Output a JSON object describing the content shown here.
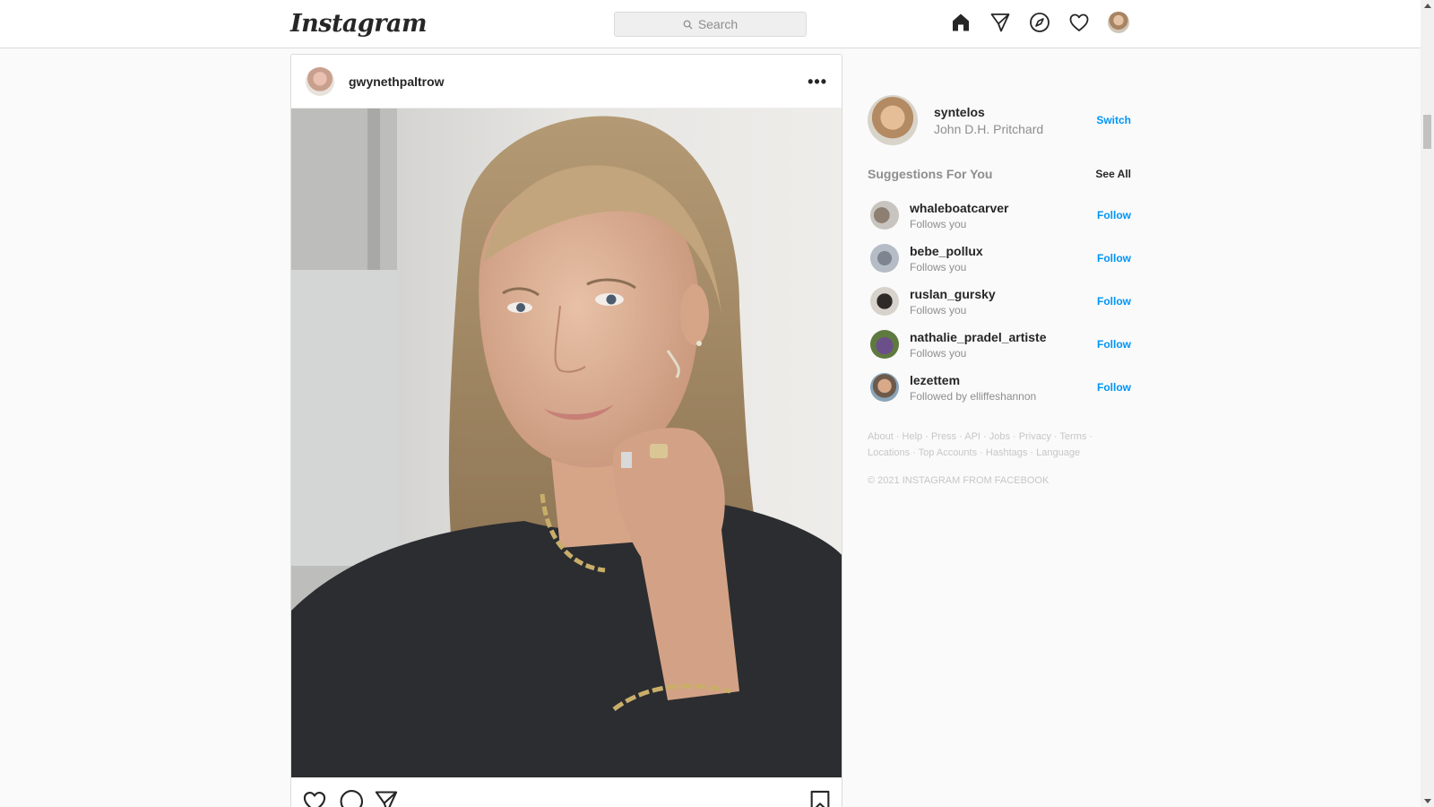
{
  "header": {
    "logo_text": "Instagram",
    "search_placeholder": "Search",
    "nav_icons": [
      "home-icon",
      "direct-icon",
      "explore-icon",
      "activity-heart-icon",
      "profile-avatar"
    ]
  },
  "post": {
    "username": "gwynethpaltrow",
    "more_label": "•••",
    "actions": [
      "like-icon",
      "comment-icon",
      "share-icon",
      "save-icon"
    ]
  },
  "sidebar": {
    "me": {
      "username": "syntelos",
      "full_name": "John D.H. Pritchard",
      "switch_label": "Switch"
    },
    "suggestions_title": "Suggestions For You",
    "see_all_label": "See All",
    "suggestions": [
      {
        "username": "whaleboatcarver",
        "subtitle": "Follows you",
        "action": "Follow"
      },
      {
        "username": "bebe_pollux",
        "subtitle": "Follows you",
        "action": "Follow"
      },
      {
        "username": "ruslan_gursky",
        "subtitle": "Follows you",
        "action": "Follow"
      },
      {
        "username": "nathalie_pradel_artiste",
        "subtitle": "Follows you",
        "action": "Follow"
      },
      {
        "username": "lezettem",
        "subtitle": "Followed by elliffeshannon",
        "action": "Follow"
      }
    ],
    "footer_links": [
      "About",
      "Help",
      "Press",
      "API",
      "Jobs",
      "Privacy",
      "Terms",
      "Locations",
      "Top Accounts",
      "Hashtags",
      "Language"
    ],
    "copyright": "© 2021 Instagram from Facebook"
  },
  "colors": {
    "accent_blue": "#0095f6",
    "border": "#dbdbdb",
    "muted_text": "#8e8e8e",
    "background": "#fafafa"
  }
}
